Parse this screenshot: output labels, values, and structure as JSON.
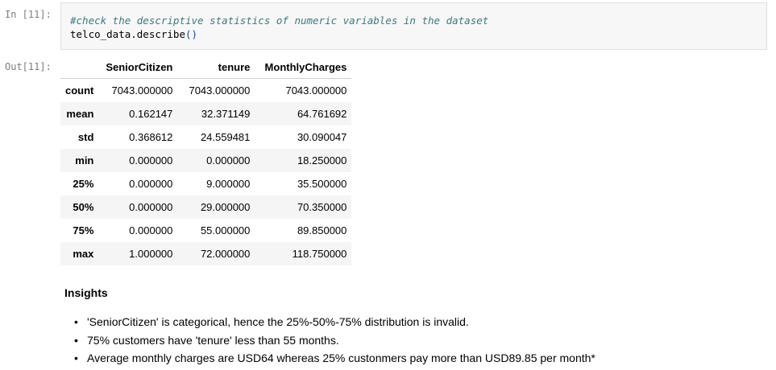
{
  "cells": {
    "input_prompt": "In [11]:",
    "output_prompt": "Out[11]:",
    "code": {
      "comment": "#check the descriptive statistics of numeric variables in the dataset",
      "call": "telco_data.describe",
      "parens": "()"
    }
  },
  "table": {
    "columns": [
      "SeniorCitizen",
      "tenure",
      "MonthlyCharges"
    ],
    "rows": [
      {
        "label": "count",
        "values": [
          "7043.000000",
          "7043.000000",
          "7043.000000"
        ]
      },
      {
        "label": "mean",
        "values": [
          "0.162147",
          "32.371149",
          "64.761692"
        ]
      },
      {
        "label": "std",
        "values": [
          "0.368612",
          "24.559481",
          "30.090047"
        ]
      },
      {
        "label": "min",
        "values": [
          "0.000000",
          "0.000000",
          "18.250000"
        ]
      },
      {
        "label": "25%",
        "values": [
          "0.000000",
          "9.000000",
          "35.500000"
        ]
      },
      {
        "label": "50%",
        "values": [
          "0.000000",
          "29.000000",
          "70.350000"
        ]
      },
      {
        "label": "75%",
        "values": [
          "0.000000",
          "55.000000",
          "89.850000"
        ]
      },
      {
        "label": "max",
        "values": [
          "1.000000",
          "72.000000",
          "118.750000"
        ]
      }
    ]
  },
  "insights": {
    "title": "Insights",
    "items": [
      "'SeniorCitizen' is categorical, hence the 25%-50%-75% distribution is invalid.",
      "75% customers have 'tenure' less than 55 months.",
      "Average monthly charges are USD64 whereas 25% custonmers pay more than USD89.85 per month*"
    ]
  }
}
